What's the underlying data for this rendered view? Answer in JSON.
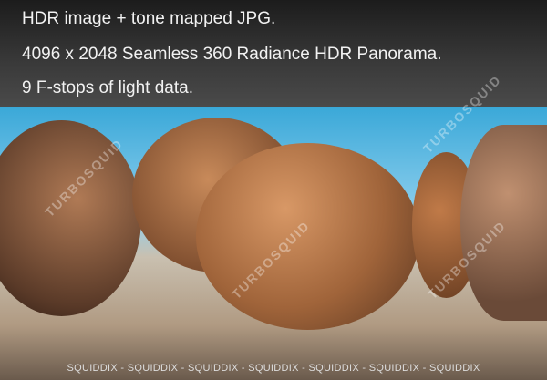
{
  "header": {
    "lines": [
      "HDR image + tone mapped JPG.",
      "4096 x 2048  Seamless 360 Radiance HDR Panorama.",
      "9 F-stops of light data."
    ]
  },
  "watermark": {
    "brand": "TURBOSQUID",
    "footer": "SQUIDDIX  -  SQUIDDIX  -  SQUIDDIX  -  SQUIDDIX  -  SQUIDDIX  -  SQUIDDIX  -  SQUIDDIX"
  }
}
